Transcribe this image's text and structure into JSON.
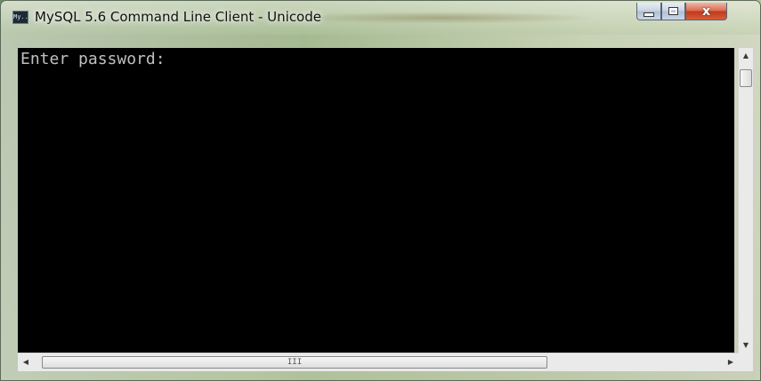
{
  "window": {
    "title": "MySQL 5.6 Command Line Client - Unicode",
    "icon": "mysql-console-icon",
    "icon_text": "My..",
    "controls": {
      "minimize": "minimize-icon",
      "maximize": "maximize-icon",
      "close": "close-icon",
      "close_glyph": "x"
    }
  },
  "console": {
    "prompt": "Enter password:",
    "background": "#000000",
    "foreground": "#c0c0c0"
  },
  "scrollbars": {
    "vertical": {
      "up_glyph": "▲",
      "down_glyph": "▼"
    },
    "horizontal": {
      "left_glyph": "◀",
      "right_glyph": "▶",
      "grip": "III"
    }
  },
  "colors": {
    "close_button": "#c2361a",
    "console_bg": "#000000"
  }
}
